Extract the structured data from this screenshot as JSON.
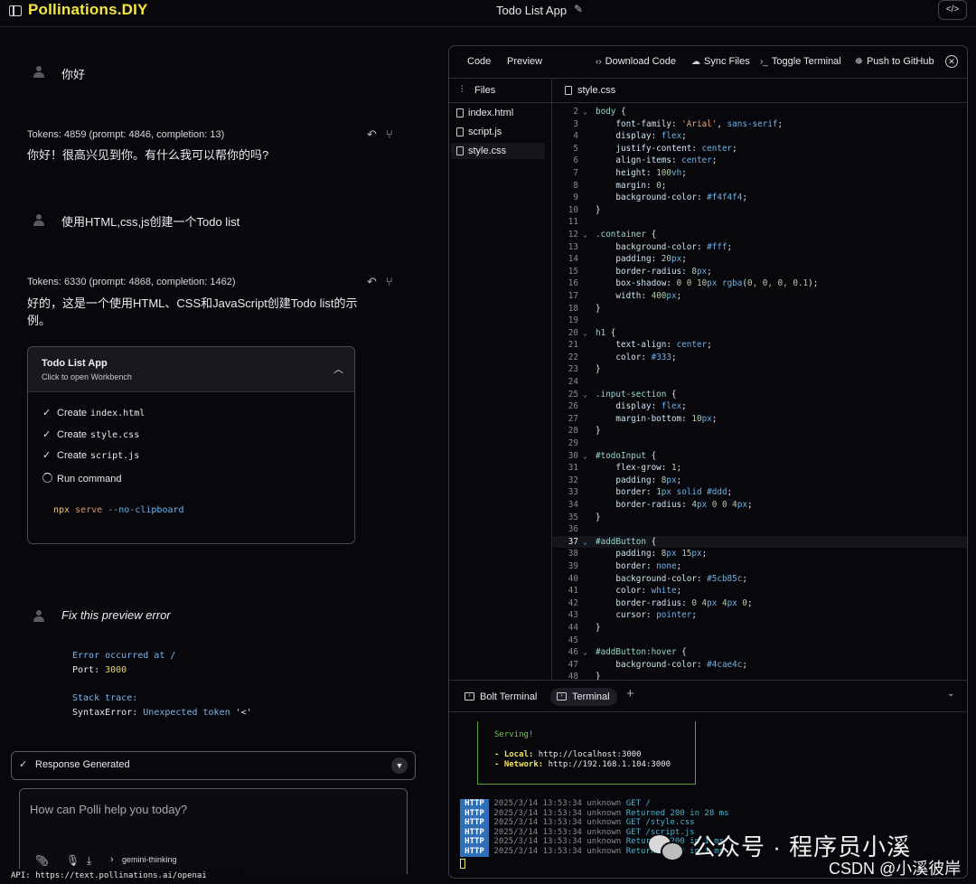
{
  "header": {
    "logo": "Pollinations.DIY",
    "title": "Todo List App",
    "code_toggle_icon": "</>"
  },
  "chat": {
    "msg1": "你好",
    "tokens1": "Tokens: 4859 (prompt: 4846, completion: 13)",
    "reply1": "你好！很高兴见到你。有什么我可以帮你的吗?",
    "msg2": "使用HTML,css,js创建一个Todo list",
    "tokens2": "Tokens: 6330 (prompt: 4868, completion: 1462)",
    "reply2_line1": "好的，这是一个使用HTML、CSS和JavaScript创建Todo list的示",
    "reply2_line2": "例。",
    "artifact": {
      "title": "Todo List App",
      "subtitle": "Click to open Workbench",
      "actions": [
        {
          "verb": "Create",
          "file": "index.html"
        },
        {
          "verb": "Create",
          "file": "style.css"
        },
        {
          "verb": "Create",
          "file": "script.js"
        }
      ],
      "run_label": "Run command",
      "cmd_1": "npx",
      "cmd_2": "serve",
      "cmd_3": "--no-clipboard"
    },
    "msg3": "Fix this preview error",
    "error": {
      "l1": "Error occurred at /",
      "l2_key": "Port: ",
      "l2_val": "3000",
      "l3": "Stack trace:",
      "l4_key": "SyntaxError: ",
      "l4_val": "Unexpected token",
      "l4_tail": " '<'"
    },
    "response_label": "Response Generated",
    "input_placeholder": "How can Polli help you today?",
    "model": "gemini-thinking",
    "api": "API: https://text.pollinations.ai/openai"
  },
  "workbench": {
    "tabs": [
      "Code",
      "Preview"
    ],
    "actions": [
      "Download Code",
      "Sync Files",
      "Toggle Terminal",
      "Push to GitHub"
    ],
    "files_label": "Files",
    "files": [
      "index.html",
      "script.js",
      "style.css"
    ],
    "active_file": "style.css",
    "terminal_tabs": [
      "Bolt Terminal",
      "Terminal"
    ]
  },
  "code": [
    {
      "n": "2",
      "fold": "v",
      "t": [
        [
          "sel",
          "body "
        ],
        [
          "",
          "{"
        ]
      ]
    },
    {
      "n": "3",
      "t": [
        [
          "",
          "    "
        ],
        [
          "prop",
          "font-family"
        ],
        [
          "",
          ": "
        ],
        [
          "str",
          "'Arial'"
        ],
        [
          "",
          ", "
        ],
        [
          "val",
          "sans-serif"
        ],
        [
          "",
          ";"
        ]
      ]
    },
    {
      "n": "4",
      "t": [
        [
          "",
          "    "
        ],
        [
          "prop",
          "display"
        ],
        [
          "",
          ": "
        ],
        [
          "val",
          "flex"
        ],
        [
          "",
          ";"
        ]
      ]
    },
    {
      "n": "5",
      "t": [
        [
          "",
          "    "
        ],
        [
          "prop",
          "justify-content"
        ],
        [
          "",
          ": "
        ],
        [
          "val",
          "center"
        ],
        [
          "",
          ";"
        ]
      ]
    },
    {
      "n": "6",
      "t": [
        [
          "",
          "    "
        ],
        [
          "prop",
          "align-items"
        ],
        [
          "",
          ": "
        ],
        [
          "val",
          "center"
        ],
        [
          "",
          ";"
        ]
      ]
    },
    {
      "n": "7",
      "t": [
        [
          "",
          "    "
        ],
        [
          "prop",
          "height"
        ],
        [
          "",
          ": "
        ],
        [
          "num",
          "100"
        ],
        [
          "unit",
          "vh"
        ],
        [
          "",
          ";"
        ]
      ]
    },
    {
      "n": "8",
      "t": [
        [
          "",
          "    "
        ],
        [
          "prop",
          "margin"
        ],
        [
          "",
          ": "
        ],
        [
          "num",
          "0"
        ],
        [
          "",
          ";"
        ]
      ]
    },
    {
      "n": "9",
      "t": [
        [
          "",
          "    "
        ],
        [
          "prop",
          "background-color"
        ],
        [
          "",
          ": "
        ],
        [
          "val",
          "#f4f4f4"
        ],
        [
          "",
          ";"
        ]
      ]
    },
    {
      "n": "10",
      "t": [
        [
          "",
          "}"
        ]
      ]
    },
    {
      "n": "11",
      "t": []
    },
    {
      "n": "12",
      "fold": "v",
      "t": [
        [
          "sel",
          ".container "
        ],
        [
          "",
          "{"
        ]
      ]
    },
    {
      "n": "13",
      "t": [
        [
          "",
          "    "
        ],
        [
          "prop",
          "background-color"
        ],
        [
          "",
          ": "
        ],
        [
          "val",
          "#fff"
        ],
        [
          "",
          ";"
        ]
      ]
    },
    {
      "n": "14",
      "t": [
        [
          "",
          "    "
        ],
        [
          "prop",
          "padding"
        ],
        [
          "",
          ": "
        ],
        [
          "num",
          "20"
        ],
        [
          "unit",
          "px"
        ],
        [
          "",
          ";"
        ]
      ]
    },
    {
      "n": "15",
      "t": [
        [
          "",
          "    "
        ],
        [
          "prop",
          "border-radius"
        ],
        [
          "",
          ": "
        ],
        [
          "num",
          "8"
        ],
        [
          "unit",
          "px"
        ],
        [
          "",
          ";"
        ]
      ]
    },
    {
      "n": "16",
      "t": [
        [
          "",
          "    "
        ],
        [
          "prop",
          "box-shadow"
        ],
        [
          "",
          ": "
        ],
        [
          "num",
          "0 0 10"
        ],
        [
          "unit",
          "px"
        ],
        [
          "",
          ""
        ],
        [
          "val",
          " rgba"
        ],
        [
          "",
          "("
        ],
        [
          "num",
          "0, 0, 0, 0.1"
        ],
        [
          "",
          ");"
        ]
      ]
    },
    {
      "n": "17",
      "t": [
        [
          "",
          "    "
        ],
        [
          "prop",
          "width"
        ],
        [
          "",
          ": "
        ],
        [
          "num",
          "400"
        ],
        [
          "unit",
          "px"
        ],
        [
          "",
          ";"
        ]
      ]
    },
    {
      "n": "18",
      "t": [
        [
          "",
          "}"
        ]
      ]
    },
    {
      "n": "19",
      "t": []
    },
    {
      "n": "20",
      "fold": "v",
      "t": [
        [
          "sel",
          "h1 "
        ],
        [
          "",
          "{"
        ]
      ]
    },
    {
      "n": "21",
      "t": [
        [
          "",
          "    "
        ],
        [
          "prop",
          "text-align"
        ],
        [
          "",
          ": "
        ],
        [
          "val",
          "center"
        ],
        [
          "",
          ";"
        ]
      ]
    },
    {
      "n": "22",
      "t": [
        [
          "",
          "    "
        ],
        [
          "prop",
          "color"
        ],
        [
          "",
          ": "
        ],
        [
          "val",
          "#333"
        ],
        [
          "",
          ";"
        ]
      ]
    },
    {
      "n": "23",
      "t": [
        [
          "",
          "}"
        ]
      ]
    },
    {
      "n": "24",
      "t": []
    },
    {
      "n": "25",
      "fold": "v",
      "t": [
        [
          "sel",
          ".input-section "
        ],
        [
          "",
          "{"
        ]
      ]
    },
    {
      "n": "26",
      "t": [
        [
          "",
          "    "
        ],
        [
          "prop",
          "display"
        ],
        [
          "",
          ": "
        ],
        [
          "val",
          "flex"
        ],
        [
          "",
          ";"
        ]
      ]
    },
    {
      "n": "27",
      "t": [
        [
          "",
          "    "
        ],
        [
          "prop",
          "margin-bottom"
        ],
        [
          "",
          ": "
        ],
        [
          "num",
          "10"
        ],
        [
          "unit",
          "px"
        ],
        [
          "",
          ";"
        ]
      ]
    },
    {
      "n": "28",
      "t": [
        [
          "",
          "}"
        ]
      ]
    },
    {
      "n": "29",
      "t": []
    },
    {
      "n": "30",
      "fold": "v",
      "t": [
        [
          "sel",
          "#todoInput "
        ],
        [
          "",
          "{"
        ]
      ]
    },
    {
      "n": "31",
      "t": [
        [
          "",
          "    "
        ],
        [
          "prop",
          "flex-grow"
        ],
        [
          "",
          ": "
        ],
        [
          "num",
          "1"
        ],
        [
          "",
          ";"
        ]
      ]
    },
    {
      "n": "32",
      "t": [
        [
          "",
          "    "
        ],
        [
          "prop",
          "padding"
        ],
        [
          "",
          ": "
        ],
        [
          "num",
          "8"
        ],
        [
          "unit",
          "px"
        ],
        [
          "",
          ";"
        ]
      ]
    },
    {
      "n": "33",
      "t": [
        [
          "",
          "    "
        ],
        [
          "prop",
          "border"
        ],
        [
          "",
          ": "
        ],
        [
          "num",
          "1"
        ],
        [
          "unit",
          "px"
        ],
        [
          "val",
          " solid #ddd"
        ],
        [
          "",
          ";"
        ]
      ]
    },
    {
      "n": "34",
      "t": [
        [
          "",
          "    "
        ],
        [
          "prop",
          "border-radius"
        ],
        [
          "",
          ": "
        ],
        [
          "num",
          "4"
        ],
        [
          "unit",
          "px"
        ],
        [
          "num",
          " 0 0 4"
        ],
        [
          "unit",
          "px"
        ],
        [
          "",
          ";"
        ]
      ]
    },
    {
      "n": "35",
      "t": [
        [
          "",
          "}"
        ]
      ]
    },
    {
      "n": "36",
      "t": []
    },
    {
      "n": "37",
      "fold": "v",
      "hl": true,
      "t": [
        [
          "sel",
          "#addButton "
        ],
        [
          "",
          "{"
        ]
      ]
    },
    {
      "n": "38",
      "t": [
        [
          "",
          "    "
        ],
        [
          "prop",
          "padding"
        ],
        [
          "",
          ": "
        ],
        [
          "num",
          "8"
        ],
        [
          "unit",
          "px"
        ],
        [
          "num",
          " 15"
        ],
        [
          "unit",
          "px"
        ],
        [
          "",
          ";"
        ]
      ]
    },
    {
      "n": "39",
      "t": [
        [
          "",
          "    "
        ],
        [
          "prop",
          "border"
        ],
        [
          "",
          ": "
        ],
        [
          "val",
          "none"
        ],
        [
          "",
          ";"
        ]
      ]
    },
    {
      "n": "40",
      "t": [
        [
          "",
          "    "
        ],
        [
          "prop",
          "background-color"
        ],
        [
          "",
          ": "
        ],
        [
          "val",
          "#5cb85c"
        ],
        [
          "",
          ";"
        ]
      ]
    },
    {
      "n": "41",
      "t": [
        [
          "",
          "    "
        ],
        [
          "prop",
          "color"
        ],
        [
          "",
          ": "
        ],
        [
          "val",
          "white"
        ],
        [
          "",
          ";"
        ]
      ]
    },
    {
      "n": "42",
      "t": [
        [
          "",
          "    "
        ],
        [
          "prop",
          "border-radius"
        ],
        [
          "",
          ": "
        ],
        [
          "num",
          "0 4"
        ],
        [
          "unit",
          "px"
        ],
        [
          "num",
          " 4"
        ],
        [
          "unit",
          "px"
        ],
        [
          "num",
          " 0"
        ],
        [
          "",
          ";"
        ]
      ]
    },
    {
      "n": "43",
      "t": [
        [
          "",
          "    "
        ],
        [
          "prop",
          "cursor"
        ],
        [
          "",
          ": "
        ],
        [
          "val",
          "pointer"
        ],
        [
          "",
          ";"
        ]
      ]
    },
    {
      "n": "44",
      "t": [
        [
          "",
          "}"
        ]
      ]
    },
    {
      "n": "45",
      "t": []
    },
    {
      "n": "46",
      "fold": "v",
      "t": [
        [
          "sel",
          "#addButton:hover "
        ],
        [
          "",
          "{"
        ]
      ]
    },
    {
      "n": "47",
      "t": [
        [
          "",
          "    "
        ],
        [
          "prop",
          "background-color"
        ],
        [
          "",
          ": "
        ],
        [
          "val",
          "#4cae4c"
        ],
        [
          "",
          ";"
        ]
      ]
    },
    {
      "n": "48",
      "t": [
        [
          "",
          "}"
        ]
      ]
    }
  ],
  "terminal": {
    "serving": "Serving!",
    "local_key": "- Local:",
    "local_val": "http://localhost:3000",
    "network_key": "- Network:",
    "network_val": "http://192.168.1.104:3000",
    "logs": [
      {
        "badge": "HTTP",
        "ts": "2025/3/14 13:53:34 unknown",
        "msg": "GET /"
      },
      {
        "badge": "HTTP",
        "ts": "2025/3/14 13:53:34 unknown",
        "msg": "Returned 200 in 28 ms"
      },
      {
        "badge": "HTTP",
        "ts": "2025/3/14 13:53:34 unknown",
        "msg": "GET /style.css"
      },
      {
        "badge": "HTTP",
        "ts": "2025/3/14 13:53:34 unknown",
        "msg": "GET /script.js"
      },
      {
        "badge": "HTTP",
        "ts": "2025/3/14 13:53:34 unknown",
        "msg": "Returned 200 in 1 ms"
      },
      {
        "badge": "HTTP",
        "ts": "2025/3/14 13:53:34 unknown",
        "msg": "Returned 200 in 1 ms"
      }
    ]
  },
  "watermark": {
    "mid": "公众号 · 程序员小溪",
    "bottom": "CSDN @小溪彼岸"
  },
  "colors": {
    "brand": "#f5e642",
    "background": "#07070c",
    "accent_blue": "#6fb3e6",
    "terminal_green": "#5fa032"
  }
}
